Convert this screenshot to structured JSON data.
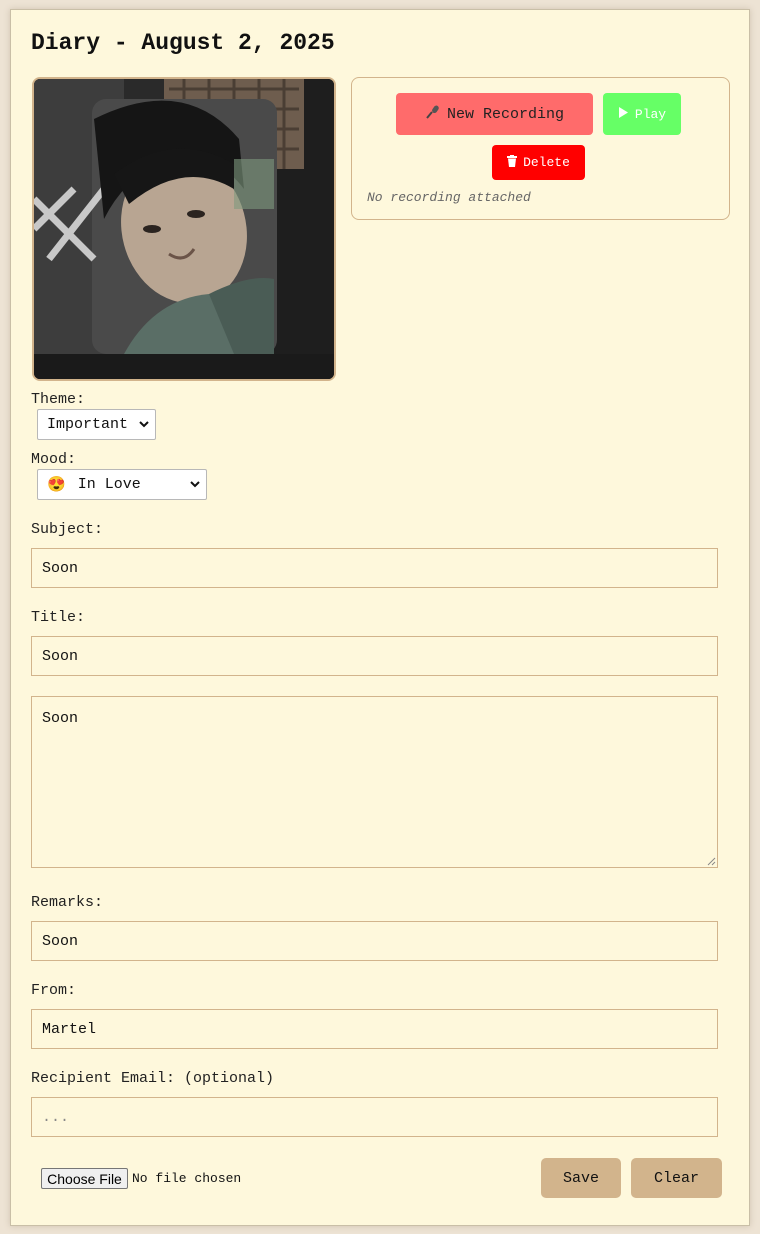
{
  "page": {
    "title": "Diary - August 2, 2025"
  },
  "recorder": {
    "new_recording_label": "New Recording",
    "play_label": "Play",
    "delete_label": "Delete",
    "status_text": "No recording attached",
    "icons": {
      "new": "microphone-icon",
      "play": "play-icon",
      "delete": "trash-icon"
    },
    "colors": {
      "new": "#ff6b6b",
      "play": "#66ff66",
      "delete": "#ff0000"
    }
  },
  "form": {
    "theme_label": "Theme:",
    "theme_value": "Important",
    "mood_label": "Mood:",
    "mood_emoji": "😍",
    "mood_value": "In Love",
    "subject_label": "Subject:",
    "subject_value": "Soon",
    "title_label": "Title:",
    "title_value": "Soon",
    "body_value": "Soon",
    "remarks_label": "Remarks:",
    "remarks_value": "Soon",
    "from_label": "From:",
    "from_value": "Martel",
    "email_label": "Recipient Email: (optional)",
    "email_placeholder": "..."
  },
  "footer": {
    "choose_file_label": "Choose File",
    "file_status": "No file chosen",
    "save_label": "Save",
    "clear_label": "Clear"
  },
  "colors": {
    "page_background": "#fef8dc",
    "accent": "#d2b48c"
  }
}
